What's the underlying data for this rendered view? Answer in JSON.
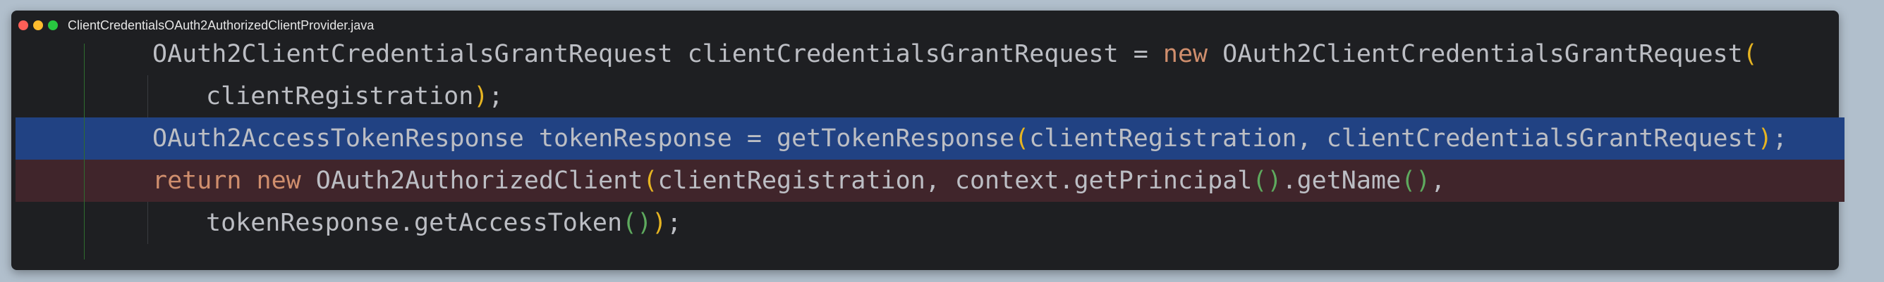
{
  "window": {
    "title": "ClientCredentialsOAuth2AuthorizedClientProvider.java"
  },
  "colors": {
    "background": "#b1bfcc",
    "editor": "#1e1f22",
    "selection": "#214283",
    "error_line": "#40252b",
    "keyword": "#cf8e6d",
    "paren_outer": "#e6b422",
    "paren_inner": "#5eaa5e",
    "text": "#bcbec4"
  },
  "code": {
    "line1": {
      "a": "OAuth2ClientCredentialsGrantRequest clientCredentialsGrantRequest = ",
      "kw": "new",
      "b": " OAuth2ClientCredentialsGrantRequest",
      "p_open": "("
    },
    "line2": {
      "a": "clientRegistration",
      "p_close": ")",
      "b": ";"
    },
    "line3": {
      "a": "OAuth2AccessTokenResponse tokenResponse = getTokenResponse",
      "p_open": "(",
      "b": "clientRegistration, clientCredentialsGrantRequest",
      "p_close": ")",
      "c": ";"
    },
    "line4": {
      "kw1": "return",
      "sp1": " ",
      "kw2": "new",
      "a": " OAuth2AuthorizedClient",
      "p_open": "(",
      "b": "clientRegistration, context.getPrincipal",
      "q_open": "(",
      "q_close": ")",
      "c": ".getName",
      "r_open": "(",
      "r_close": ")",
      "d": ","
    },
    "line5": {
      "a": "tokenResponse.getAccessToken",
      "q_open": "(",
      "q_close": ")",
      "p_close": ")",
      "b": ";"
    }
  }
}
